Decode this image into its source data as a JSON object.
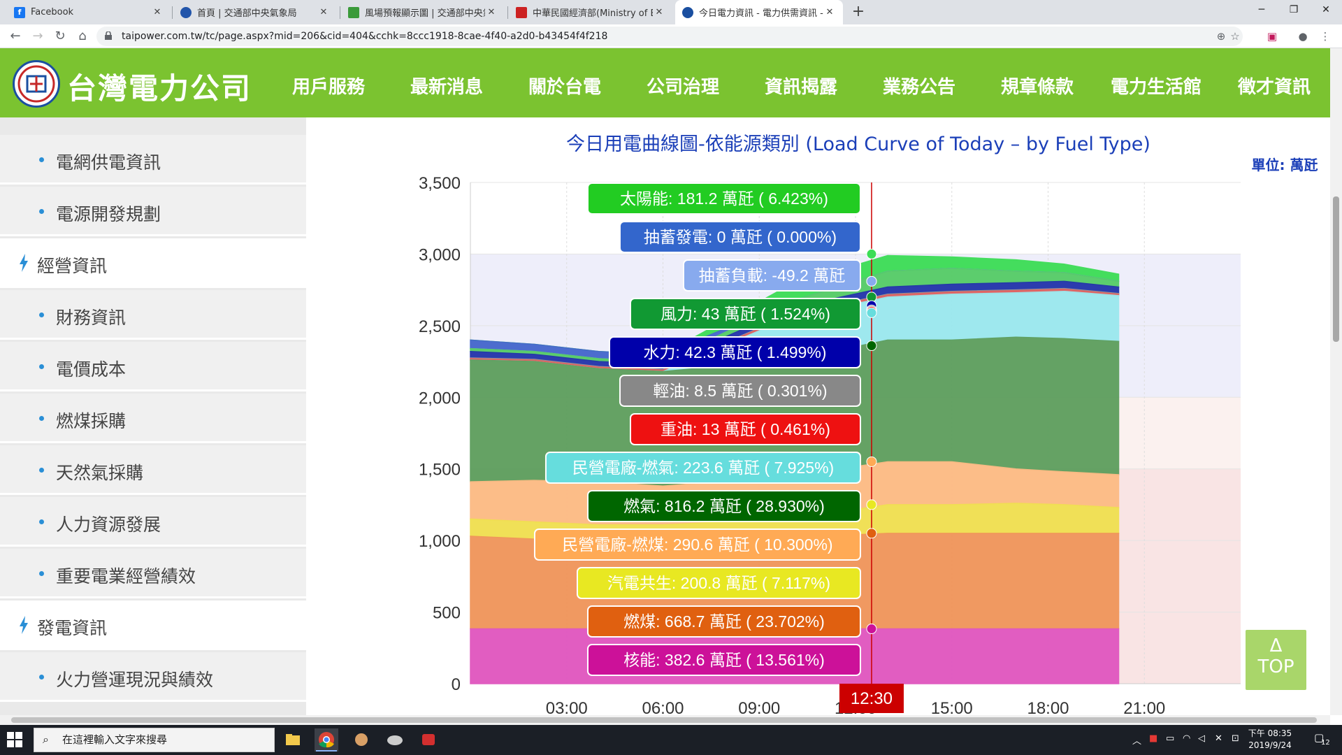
{
  "browser": {
    "tabs": [
      {
        "label": "Facebook",
        "favicon": "facebook-icon",
        "color": "#1877f2"
      },
      {
        "label": "首頁 | 交通部中央氣象局",
        "favicon": "cwb-icon",
        "color": "#2255aa"
      },
      {
        "label": "風場預報顯示圖 | 交通部中央氣象",
        "favicon": "map-icon",
        "color": "#3a9a3a"
      },
      {
        "label": "中華民國經濟部(Ministry of Econ",
        "favicon": "moea-icon",
        "color": "#cc2222"
      },
      {
        "label": "今日電力資訊 - 電力供需資訊 - 台",
        "favicon": "taipower-icon",
        "color": "#1a4fa0"
      }
    ],
    "url": "taipower.com.tw/tc/page.aspx?mid=206&cid=404&cchk=8ccc1918-8cae-4f40-a2d0-b43454f4f218"
  },
  "site": {
    "logo_text": "台灣電力公司",
    "menu": [
      "用戶服務",
      "最新消息",
      "關於台電",
      "公司治理",
      "資訊揭露",
      "業務公告",
      "規章條款",
      "電力生活館",
      "徵才資訊"
    ],
    "active_menu": "資訊揭露"
  },
  "sidebar": {
    "items": [
      {
        "label": "電網供電資訊",
        "level": "child"
      },
      {
        "label": "電源開發規劃",
        "level": "child"
      },
      {
        "label": "經營資訊",
        "level": "parent"
      },
      {
        "label": "財務資訊",
        "level": "child"
      },
      {
        "label": "電價成本",
        "level": "child"
      },
      {
        "label": "燃煤採購",
        "level": "child"
      },
      {
        "label": "天然氣採購",
        "level": "child"
      },
      {
        "label": "人力資源發展",
        "level": "child"
      },
      {
        "label": "重要電業經營績效",
        "level": "child"
      },
      {
        "label": "發電資訊",
        "level": "parent"
      },
      {
        "label": "火力營運現況與績效",
        "level": "child"
      }
    ]
  },
  "top_button": {
    "arrow": "Δ",
    "label": "TOP"
  },
  "taskbar": {
    "search_placeholder": "在這裡輸入文字來搜尋",
    "time": "下午 08:35",
    "date": "2019/9/24",
    "notification_count": "12"
  },
  "chart_data": {
    "type": "area",
    "title": "今日用電曲線圖-依能源類別 (Load Curve of Today – by Fuel Type)",
    "unit": "單位: 萬瓩",
    "ylim": [
      0,
      3500
    ],
    "y_ticks": [
      "0",
      "500",
      "1,000",
      "1,500",
      "2,000",
      "2,500",
      "3,000",
      "3,500"
    ],
    "x_ticks": [
      "03:00",
      "06:00",
      "09:00",
      "12:00",
      "15:00",
      "18:00",
      "21:00"
    ],
    "x_range_hours": [
      0,
      24
    ],
    "data_end_hour": 20.2,
    "cursor_time": "12:30",
    "cursor_hour": 12.5,
    "stack_order": [
      "核能",
      "燃煤",
      "汽電共生",
      "民營電廠-燃煤",
      "燃氣",
      "民營電廠-燃氣",
      "重油",
      "輕油",
      "水力",
      "風力",
      "抽蓄負載",
      "抽蓄發電",
      "太陽能"
    ],
    "series": [
      {
        "name": "核能",
        "color": "#e056c0",
        "values": [
          383,
          383,
          383,
          383,
          383,
          383,
          383,
          383,
          383,
          383
        ]
      },
      {
        "name": "燃煤",
        "color": "#f0955a",
        "values": [
          1030,
          1010,
          1000,
          1000,
          1020,
          1050,
          1050,
          1050,
          1050,
          1050
        ]
      },
      {
        "name": "汽電共生",
        "color": "#f0e050",
        "values": [
          1150,
          1130,
          1110,
          1110,
          1150,
          1250,
          1250,
          1260,
          1250,
          1230
        ]
      },
      {
        "name": "民營電廠-燃煤",
        "color": "#fdbb84",
        "values": [
          1410,
          1420,
          1410,
          1380,
          1450,
          1550,
          1550,
          1500,
          1480,
          1460
        ]
      },
      {
        "name": "燃氣",
        "color": "#5d9e5d",
        "values": [
          2260,
          2250,
          2200,
          2180,
          2260,
          2400,
          2400,
          2420,
          2410,
          2390
        ]
      },
      {
        "name": "民營電廠-燃氣",
        "color": "#9ae8ee",
        "values": [
          2260,
          2250,
          2200,
          2180,
          2560,
          2700,
          2720,
          2730,
          2740,
          2710
        ]
      },
      {
        "name": "重油",
        "color": "#e06060",
        "values": [
          2270,
          2260,
          2210,
          2190,
          2575,
          2715,
          2735,
          2745,
          2755,
          2720
        ]
      },
      {
        "name": "輕油",
        "color": "#999999",
        "values": [
          2275,
          2265,
          2215,
          2195,
          2580,
          2720,
          2740,
          2750,
          2760,
          2725
        ]
      },
      {
        "name": "水力",
        "color": "#2233aa",
        "values": [
          2320,
          2300,
          2250,
          2230,
          2625,
          2770,
          2790,
          2800,
          2810,
          2770
        ]
      },
      {
        "name": "風力",
        "color": "#55cc66",
        "values": [
          2340,
          2320,
          2270,
          2250,
          2670,
          2880,
          2900,
          2880,
          2870,
          2810
        ]
      },
      {
        "name": "抽蓄負載",
        "color": "#88aaee",
        "values": [
          2340,
          2320,
          2270,
          2250,
          2670,
          2880,
          2900,
          2880,
          2870,
          2810
        ]
      },
      {
        "name": "抽蓄發電",
        "color": "#4466cc",
        "values": [
          2400,
          2370,
          2320,
          2300,
          2670,
          2880,
          2900,
          2880,
          2870,
          2810
        ]
      },
      {
        "name": "太陽能",
        "color": "#3bdd55",
        "values": [
          2400,
          2370,
          2320,
          2300,
          2790,
          2990,
          2980,
          2960,
          2930,
          2860
        ]
      }
    ],
    "sample_hours": [
      0,
      2,
      4,
      6,
      10,
      13,
      15,
      17,
      18.5,
      20.2
    ],
    "tooltip": [
      {
        "text": "太陽能: 181.2 萬瓩 ( 6.423%)",
        "bg": "#22cc22",
        "fg": "#ffffff",
        "dot": "#3bdd55",
        "y": 3000
      },
      {
        "text": "抽蓄發電: 0 萬瓩 ( 0.000%)",
        "bg": "#3366cc",
        "fg": "#ffffff",
        "dot": "#4466cc",
        "y": 2810
      },
      {
        "text": "抽蓄負載: -49.2 萬瓩",
        "bg": "#88aaee",
        "fg": "#ffffff",
        "dot": "#88aaee",
        "y": 2810
      },
      {
        "text": "風力: 43 萬瓩 ( 1.524%)",
        "bg": "#119933",
        "fg": "#ffffff",
        "dot": "#119933",
        "y": 2700
      },
      {
        "text": "水力: 42.3 萬瓩 ( 1.499%)",
        "bg": "#0000aa",
        "fg": "#ffffff",
        "dot": "#0000aa",
        "y": 2640
      },
      {
        "text": "輕油: 8.5 萬瓩 ( 0.301%)",
        "bg": "#888888",
        "fg": "#ffffff",
        "dot": "#888888",
        "y": 2610
      },
      {
        "text": "重油: 13 萬瓩 ( 0.461%)",
        "bg": "#ee1111",
        "fg": "#ffffff",
        "dot": "#ee1111",
        "y": 2600
      },
      {
        "text": "民營電廠-燃氣: 223.6 萬瓩 ( 7.925%)",
        "bg": "#66dddd",
        "fg": "#ffffff",
        "dot": "#66dddd",
        "y": 2590
      },
      {
        "text": "燃氣: 816.2 萬瓩 ( 28.930%)",
        "bg": "#006600",
        "fg": "#ffffff",
        "dot": "#006600",
        "y": 2360
      },
      {
        "text": "民營電廠-燃煤: 290.6 萬瓩 ( 10.300%)",
        "bg": "#ffaa55",
        "fg": "#ffffff",
        "dot": "#ffaa55",
        "y": 1550
      },
      {
        "text": "汽電共生: 200.8 萬瓩 ( 7.117%)",
        "bg": "#e8e822",
        "fg": "#ffffff",
        "dot": "#e8e822",
        "y": 1250
      },
      {
        "text": "燃煤: 668.7 萬瓩 ( 23.702%)",
        "bg": "#e06010",
        "fg": "#ffffff",
        "dot": "#e06010",
        "y": 1050
      },
      {
        "text": "核能: 382.6 萬瓩 ( 13.561%)",
        "bg": "#cc1199",
        "fg": "#ffffff",
        "dot": "#cc1199",
        "y": 383
      }
    ]
  }
}
